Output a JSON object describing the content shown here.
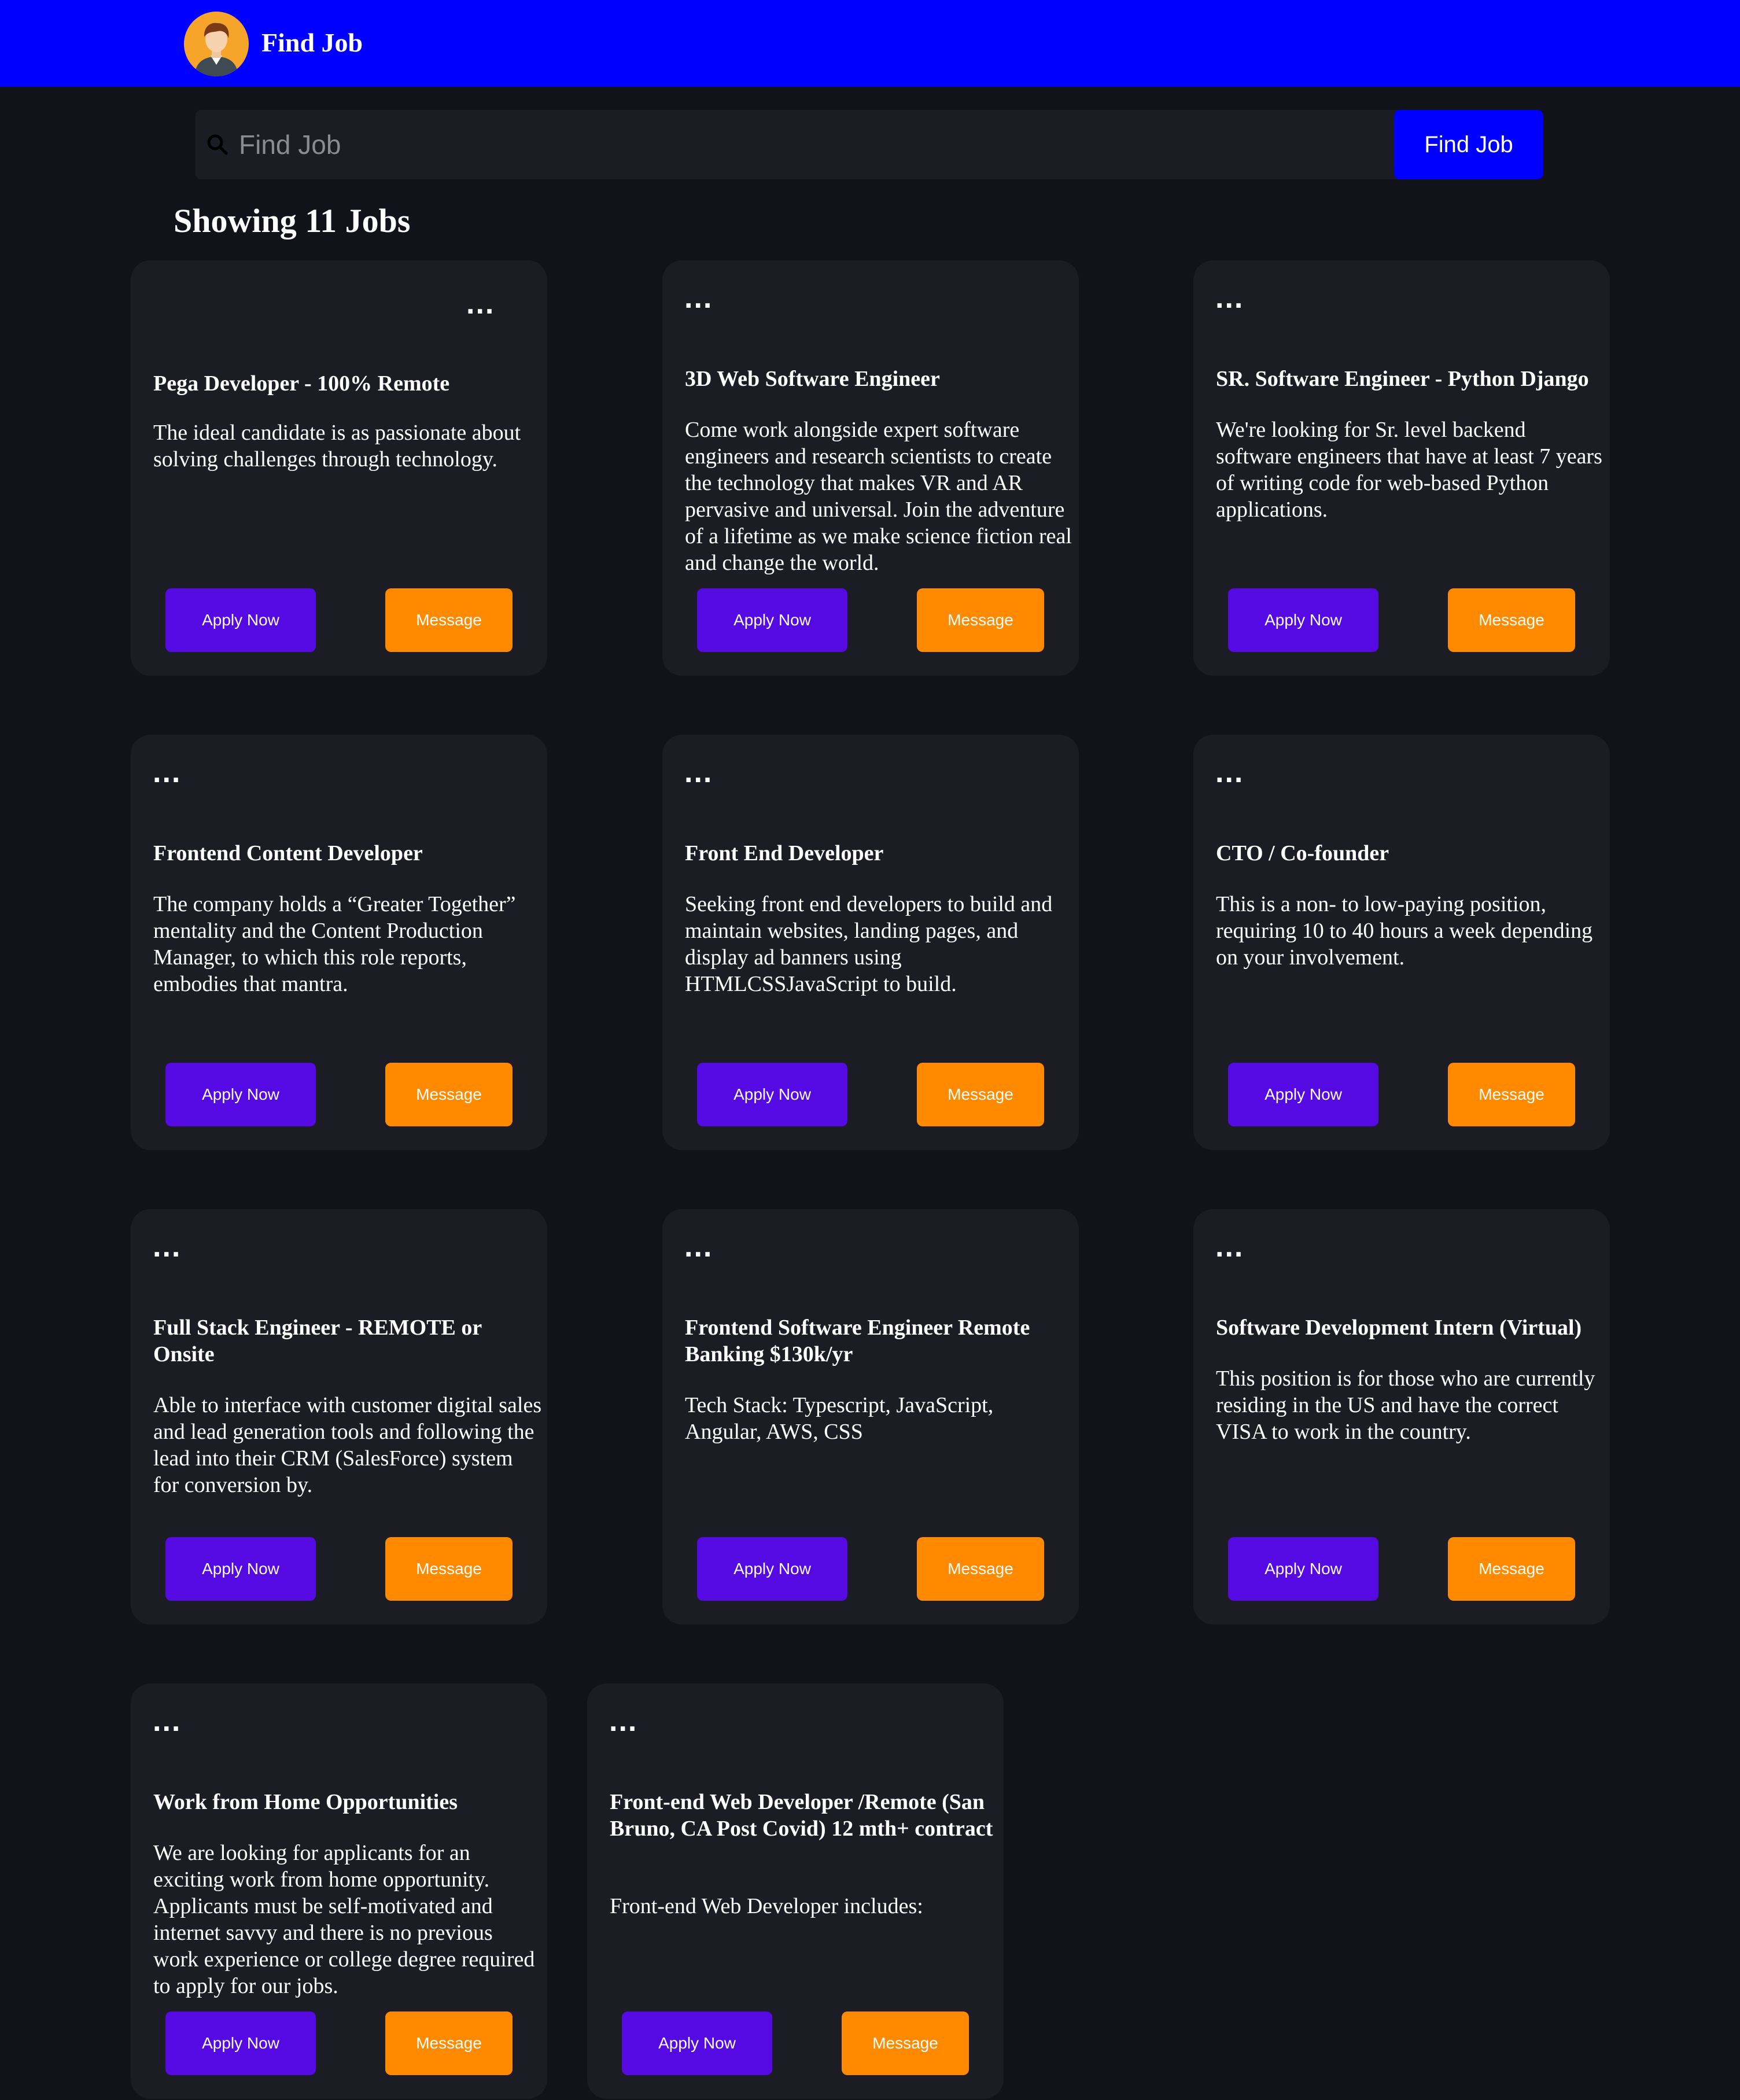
{
  "header": {
    "brand": "Find Job",
    "avatar_icon": "user-avatar-icon"
  },
  "search": {
    "placeholder": "Find Job",
    "value": "",
    "button_label": "Find Job",
    "icon": "search-icon"
  },
  "results": {
    "heading": "Showing 11 Jobs"
  },
  "colors": {
    "header": "#0000ff",
    "background": "#11121a",
    "card": "#1c1d24",
    "apply": "#5509e3",
    "message": "#ff8a00"
  },
  "jobs": [
    {
      "menu": "...",
      "title": "Pega Developer - 100% Remote",
      "description": "The ideal candidate is as passionate about solving challenges through technology.",
      "apply_label": "Apply Now",
      "message_label": "Message"
    },
    {
      "menu": "...",
      "title": "3D Web Software Engineer",
      "description": "Come work alongside expert software engineers and research scientists to create the technology that makes VR and AR pervasive and universal. Join the adventure of a lifetime as we make science fiction real and change the world.",
      "apply_label": "Apply Now",
      "message_label": "Message"
    },
    {
      "menu": "...",
      "title": "SR. Software Engineer - Python Django",
      "description": "We're looking for Sr. level backend software engineers that have at least 7 years of writing code for web-based Python applications.",
      "apply_label": "Apply Now",
      "message_label": "Message"
    },
    {
      "menu": "...",
      "title": "Frontend Content Developer",
      "description": "The company holds a “Greater Together” mentality and the Content Production Manager, to which this role reports, embodies that mantra.",
      "apply_label": "Apply Now",
      "message_label": "Message"
    },
    {
      "menu": "...",
      "title": "Front End Developer",
      "description": "Seeking front end developers to build and maintain websites, landing pages, and display ad banners using HTMLCSSJavaScript to build.",
      "apply_label": "Apply Now",
      "message_label": "Message"
    },
    {
      "menu": "...",
      "title": "CTO / Co-founder",
      "description": "This is a non- to low-paying position, requiring 10 to 40 hours a week depending on your involvement.",
      "apply_label": "Apply Now",
      "message_label": "Message"
    },
    {
      "menu": "...",
      "title": "Full Stack Engineer - REMOTE or Onsite",
      "description": "Able to interface with customer digital sales and lead generation tools and following the lead into their CRM (SalesForce) system for conversion by.",
      "apply_label": "Apply Now",
      "message_label": "Message"
    },
    {
      "menu": "...",
      "title": "Frontend Software Engineer Remote Banking $130k/yr",
      "description": "Tech Stack: Typescript, JavaScript, Angular, AWS, CSS",
      "apply_label": "Apply Now",
      "message_label": "Message"
    },
    {
      "menu": "...",
      "title": "Software Development Intern (Virtual)",
      "description": "This position is for those who are currently residing in the US and have the correct VISA to work in the country.",
      "apply_label": "Apply Now",
      "message_label": "Message"
    },
    {
      "menu": "...",
      "title": "Work from Home Opportunities",
      "description": "We are looking for applicants for an exciting work from home opportunity. Applicants must be self-motivated and internet savvy and there is no previous work experience or college degree required to apply for our jobs.",
      "apply_label": "Apply Now",
      "message_label": "Message"
    },
    {
      "menu": "...",
      "title": "Front-end Web Developer /Remote (San Bruno, CA Post Covid) 12 mth+ contract",
      "description": "Front-end Web Developer includes:",
      "apply_label": "Apply Now",
      "message_label": "Message"
    }
  ]
}
